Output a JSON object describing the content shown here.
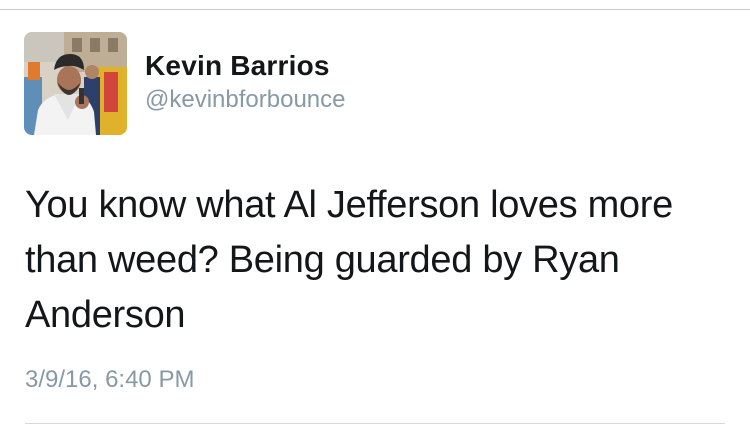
{
  "tweet": {
    "author": {
      "display_name": "Kevin Barrios",
      "handle": "@kevinbforbounce",
      "avatar_icon": "profile-photo"
    },
    "text": "You know what Al Jefferson loves more than weed? Being guarded by Ryan Anderson",
    "timestamp": "3/9/16, 6:40 PM"
  },
  "colors": {
    "name": "#14171a",
    "secondary": "#8899a6",
    "divider": "#d8d8d8"
  }
}
